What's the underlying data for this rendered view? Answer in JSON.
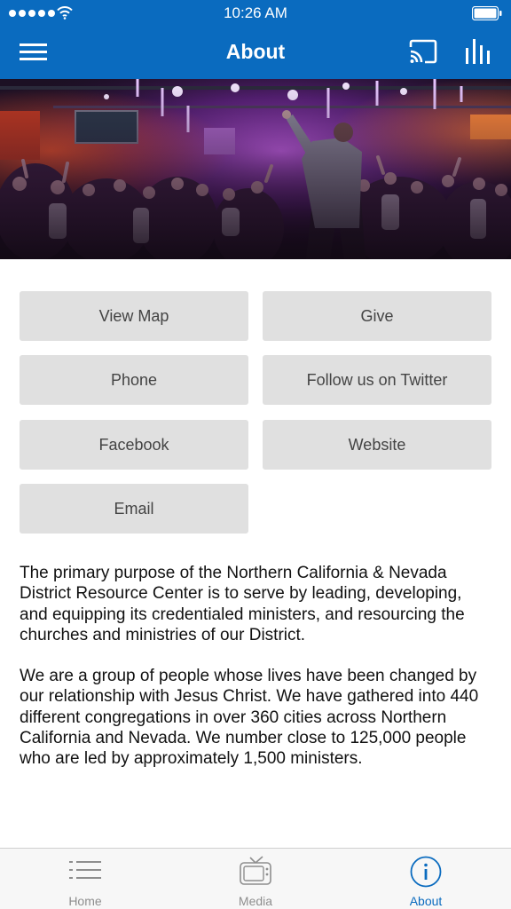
{
  "status_bar": {
    "time": "10:26 AM"
  },
  "nav": {
    "title": "About",
    "left_icon": "hamburger-menu-icon",
    "right_icons": [
      "cast-icon",
      "stats-bars-icon"
    ]
  },
  "hero": {
    "description_icon": "concert-photo"
  },
  "buttons": [
    {
      "label": "View Map"
    },
    {
      "label": "Give"
    },
    {
      "label": "Phone"
    },
    {
      "label": "Follow us on Twitter"
    },
    {
      "label": "Facebook"
    },
    {
      "label": "Website"
    },
    {
      "label": "Email"
    }
  ],
  "about": {
    "paragraphs": [
      "The primary purpose of the Northern California & Nevada District Resource Center is to serve by leading, developing, and equipping its credentialed ministers, and resourcing the churches and ministries of our District.",
      "We are a group of people whose lives have been changed by our relationship with Jesus Christ. We have gathered into 440 different congregations in over 360 cities across Northern California and Nevada. We number close to 125,000 people who are led by approximately 1,500 ministers."
    ]
  },
  "tabs": [
    {
      "label": "Home",
      "icon": "list-icon"
    },
    {
      "label": "Media",
      "icon": "tv-icon"
    },
    {
      "label": "About",
      "icon": "info-icon",
      "active": true
    }
  ],
  "colors": {
    "brand": "#0a6bbf",
    "button_bg": "#e0e0e0",
    "tab_inactive": "#8e8e8e"
  }
}
